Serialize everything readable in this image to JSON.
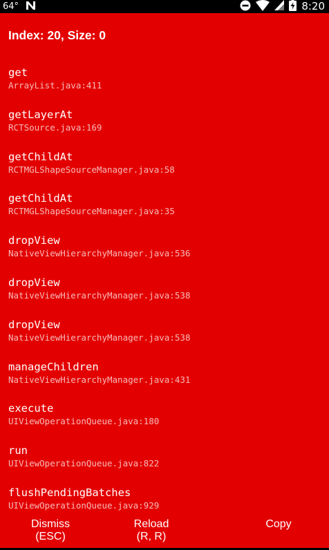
{
  "status_bar": {
    "temperature": "64°",
    "time": "8:20",
    "icons": [
      "n-notification-icon",
      "do-not-disturb-icon",
      "wifi-icon",
      "cell-signal-icon",
      "battery-charging-icon"
    ]
  },
  "error": {
    "header": "Index: 20, Size: 0",
    "background_color": "#e30000",
    "frames": [
      {
        "method": "get",
        "file": "ArrayList.java:411"
      },
      {
        "method": "getLayerAt",
        "file": "RCTSource.java:169"
      },
      {
        "method": "getChildAt",
        "file": "RCTMGLShapeSourceManager.java:58"
      },
      {
        "method": "getChildAt",
        "file": "RCTMGLShapeSourceManager.java:35"
      },
      {
        "method": "dropView",
        "file": "NativeViewHierarchyManager.java:536"
      },
      {
        "method": "dropView",
        "file": "NativeViewHierarchyManager.java:538"
      },
      {
        "method": "dropView",
        "file": "NativeViewHierarchyManager.java:538"
      },
      {
        "method": "manageChildren",
        "file": "NativeViewHierarchyManager.java:431"
      },
      {
        "method": "execute",
        "file": "UIViewOperationQueue.java:180"
      },
      {
        "method": "run",
        "file": "UIViewOperationQueue.java:822"
      },
      {
        "method": "flushPendingBatches",
        "file": "UIViewOperationQueue.java:929"
      }
    ]
  },
  "buttons": {
    "dismiss": {
      "label": "Dismiss",
      "shortcut": "(ESC)"
    },
    "reload": {
      "label": "Reload",
      "shortcut": "(R, R)"
    },
    "copy": {
      "label": "Copy"
    }
  }
}
